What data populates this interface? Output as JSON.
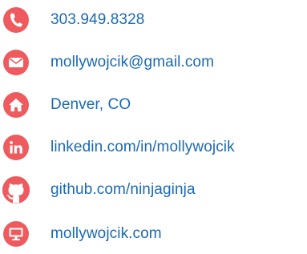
{
  "contact": {
    "accent_color": "#ee5a5e",
    "text_color": "#1a6ab5",
    "items": [
      {
        "icon": "phone-icon",
        "text": "303.949.8328"
      },
      {
        "icon": "email-icon",
        "text": "mollywojcik@gmail.com"
      },
      {
        "icon": "home-icon",
        "text": "Denver, CO"
      },
      {
        "icon": "linkedin-icon",
        "text": "linkedin.com/in/mollywojcik"
      },
      {
        "icon": "github-icon",
        "text": "github.com/ninjaginja"
      },
      {
        "icon": "computer-icon",
        "text": "mollywojcik.com"
      }
    ]
  }
}
